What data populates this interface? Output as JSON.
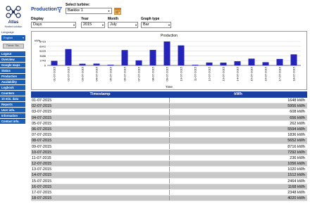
{
  "brand": {
    "name": "Atlas",
    "subtitle": "Hosted solution"
  },
  "sidebar": {
    "language_label": "Language",
    "language_value": "English",
    "theme_button": "Theme: Sta...",
    "items": [
      {
        "label": "Logout"
      },
      {
        "label": "Overview"
      },
      {
        "label": "Google maps"
      },
      {
        "label": "Status"
      },
      {
        "label": "Production"
      },
      {
        "label": "Availability"
      },
      {
        "label": "Logbook"
      },
      {
        "label": "Counters"
      },
      {
        "label": "10 min. data"
      },
      {
        "label": "Reports"
      },
      {
        "label": "User info."
      },
      {
        "label": "Information"
      },
      {
        "label": "Contact info."
      }
    ]
  },
  "header": {
    "title": "Production",
    "turbine_label": "Select turbine:",
    "turbine_value": "Bække 1"
  },
  "controls": {
    "display": {
      "label": "Display",
      "value": "Days"
    },
    "year": {
      "label": "Year",
      "value": "2015"
    },
    "month": {
      "label": "Month",
      "value": "July"
    },
    "graph_type": {
      "label": "Graph type",
      "value": "Bar"
    }
  },
  "chart_data": {
    "type": "bar",
    "title": "Production",
    "xlabel": "Time",
    "ylabel": "kWh",
    "ylim": [
      0,
      8715
    ],
    "yticks": [
      0,
      1743,
      3486,
      5229,
      6972,
      8715
    ],
    "categories": [
      "01-07-2015",
      "02-07-2015",
      "03-07-2015",
      "04-07-2015",
      "05-07-2015",
      "06-07-2015",
      "07-07-2015",
      "08-07-2015",
      "09-07-2015",
      "10-07-2015",
      "11-07-2015",
      "12-07-2015",
      "13-07-2015",
      "14-07-2015",
      "15-07-2015",
      "16-07-2015",
      "17-07-2015",
      "18-07-2015"
    ],
    "values": [
      1648,
      5956,
      608,
      656,
      262,
      5594,
      1836,
      5652,
      8716,
      7292,
      236,
      1056,
      1020,
      1512,
      2464,
      1168,
      2348,
      4020
    ],
    "bar_color": "#2424b8",
    "grid": true
  },
  "table": {
    "headers": {
      "timestamp": "Timestamp",
      "kwh": "kWh"
    },
    "rows": [
      {
        "ts": "01-07-2015",
        "kwh": "1648 kWh"
      },
      {
        "ts": "02-07-2015",
        "kwh": "5956 kWh"
      },
      {
        "ts": "03-07-2015",
        "kwh": "608 kWh"
      },
      {
        "ts": "04-07-2015",
        "kwh": "656 kWh"
      },
      {
        "ts": "05-07-2015",
        "kwh": "262 kWh"
      },
      {
        "ts": "06-07-2015",
        "kwh": "5594 kWh"
      },
      {
        "ts": "07-07-2015",
        "kwh": "1836 kWh"
      },
      {
        "ts": "08-07-2015",
        "kwh": "5652 kWh"
      },
      {
        "ts": "09-07-2015",
        "kwh": "8716 kWh"
      },
      {
        "ts": "10-07-2015",
        "kwh": "7292 kWh"
      },
      {
        "ts": "11-07-2015",
        "kwh": "236 kWh"
      },
      {
        "ts": "12-07-2015",
        "kwh": "1056 kWh"
      },
      {
        "ts": "13-07-2015",
        "kwh": "1020 kWh"
      },
      {
        "ts": "14-07-2015",
        "kwh": "1512 kWh"
      },
      {
        "ts": "15-07-2015",
        "kwh": "2464 kWh"
      },
      {
        "ts": "16-07-2015",
        "kwh": "1168 kWh"
      },
      {
        "ts": "17-07-2015",
        "kwh": "2348 kWh"
      },
      {
        "ts": "18-07-2015",
        "kwh": "4020 kWh"
      }
    ]
  }
}
